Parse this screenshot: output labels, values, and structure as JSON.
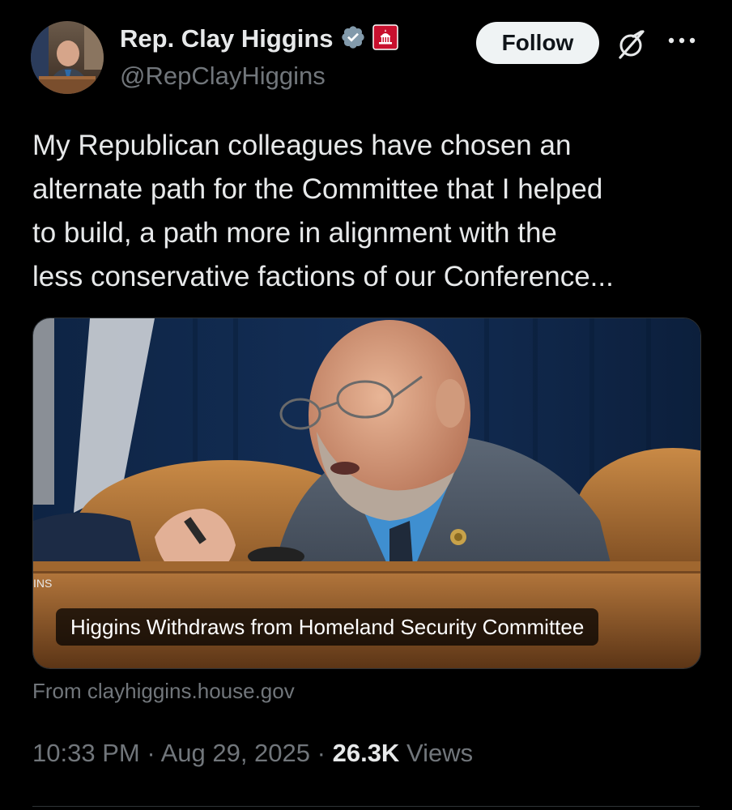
{
  "author": {
    "display_name": "Rep. Clay Higgins",
    "handle": "@RepClayHiggins",
    "verified_icon": "verified-badge-icon",
    "affiliation_icon": "government-capitol-badge-icon"
  },
  "header": {
    "follow_label": "Follow",
    "grok_icon": "grok-icon",
    "more_icon": "more-options-icon"
  },
  "tweet": {
    "text": "My Republican colleagues have chosen an\nalternate path for the Committee that I helped\nto build, a path more in alignment with the\nless conservative factions of our Conference..."
  },
  "card": {
    "caption": "Higgins Withdraws from Homeland Security Committee",
    "source": "From clayhiggins.house.gov",
    "image_sign_text": "INS"
  },
  "meta": {
    "time": "10:33 PM",
    "separator": "·",
    "date": "Aug 29, 2025",
    "views_count": "26.3K",
    "views_label": "Views"
  },
  "colors": {
    "background": "#000000",
    "text_primary": "#e7e9ea",
    "text_secondary": "#71767b",
    "verified_blue": "#829aab",
    "follow_bg": "#eff3f4",
    "divider": "#2f3336"
  }
}
